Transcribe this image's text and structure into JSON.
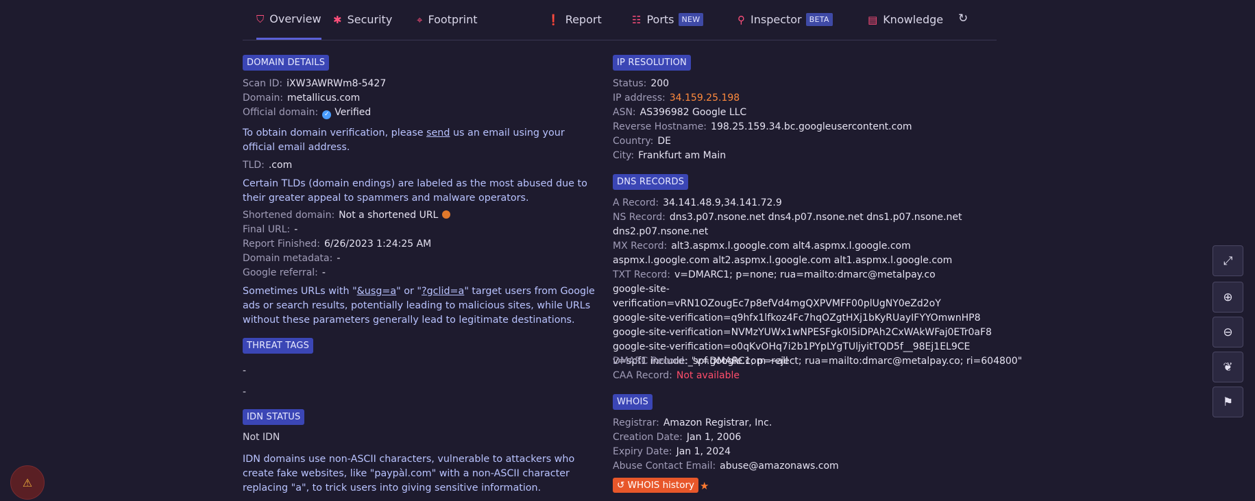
{
  "tabs": [
    {
      "label": "Overview",
      "icon": "shield-icon",
      "active": true
    },
    {
      "label": "Security",
      "icon": "bug-icon"
    },
    {
      "label": "Footprint",
      "icon": "crosshair-icon"
    },
    {
      "label": "Report",
      "icon": "exclamation-circle-icon"
    },
    {
      "label": "Ports",
      "icon": "sitemap-icon",
      "pill": "NEW"
    },
    {
      "label": "Inspector",
      "icon": "search-icon",
      "pill": "BETA"
    },
    {
      "label": "Knowledge",
      "icon": "book-icon"
    }
  ],
  "domain_details": {
    "badge": "DOMAIN DETAILS",
    "scan_id_label": "Scan ID:",
    "scan_id": "iXW3AWRWm8-5427",
    "domain_label": "Domain:",
    "domain": "metallicus.com",
    "official_label": "Official domain:",
    "official": "Verified",
    "verify_pre": "To obtain domain verification, please ",
    "verify_link": "send",
    "verify_post": " us an email using your official email address.",
    "tld_label": "TLD:",
    "tld": ".com",
    "tld_note": "Certain TLDs (domain endings) are labeled as the most abused due to their greater appeal to spammers and malware operators.",
    "shortened_label": "Shortened domain:",
    "shortened": "Not a shortened URL",
    "final_url_label": "Final URL:",
    "final_url": "-",
    "report_finished_label": "Report Finished:",
    "report_finished": "6/26/2023 1:24:25 AM",
    "metadata_label": "Domain metadata:",
    "metadata": "-",
    "referral_label": "Google referral:",
    "referral": "-",
    "referral_note_1": "Sometimes URLs with \"",
    "referral_link_1": "&usg=a",
    "referral_note_2": "\" or \"",
    "referral_link_2": "?gclid=a",
    "referral_note_3": "\" target users from Google ads or search results, potentially leading to malicious sites, while URLs without these parameters generally lead to legitimate destinations."
  },
  "threat_tags": {
    "badge": "THREAT TAGS",
    "items": [
      "-",
      "-"
    ]
  },
  "idn": {
    "badge": "IDN STATUS",
    "status": "Not IDN",
    "note": "IDN domains use non-ASCII characters, vulnerable to attackers who create fake websites, like \"paypàl.com\" with a non-ASCII character replacing \"a\", to trick users into giving sensitive information."
  },
  "ip_resolution": {
    "badge": "IP RESOLUTION",
    "status_label": "Status:",
    "status": "200",
    "ip_label": "IP address:",
    "ip": "34.159.25.198",
    "asn_label": "ASN:",
    "asn": "AS396982 Google LLC",
    "rhost_label": "Reverse Hostname:",
    "rhost": "198.25.159.34.bc.googleusercontent.com",
    "country_label": "Country:",
    "country": "DE",
    "city_label": "City:",
    "city": "Frankfurt am Main"
  },
  "dns": {
    "badge": "DNS RECORDS",
    "a_label": "A Record:",
    "a": "34.141.48.9,34.141.72.9",
    "ns_label": "NS Record:",
    "ns": "dns3.p07.nsone.net dns4.p07.nsone.net dns1.p07.nsone.net dns2.p07.nsone.net",
    "mx_label": "MX Record:",
    "mx": "alt3.aspmx.l.google.com alt4.aspmx.l.google.com aspmx.l.google.com alt2.aspmx.l.google.com alt1.aspmx.l.google.com",
    "txt_label": "TXT Record:",
    "txt_lines": [
      "v=DMARC1; p=none; rua=mailto:dmarc@metalpay.co",
      "google-site-verification=vRN1OZougEc7p8efVd4mgQXPVMFF00plUgNY0eZd2oY",
      "google-site-verification=q9hfx1lfkoz4Fc7hqOZgtHXj1bKyRUayIFYYOmwnHP8",
      "google-site-verification=NVMzYUWx1wNPESFgk0I5iDPAh2CxWAkWFaj0ETr0aF8",
      "google-site-verification=o0qKvOHq7i2b1PYpLYgTUljyitTQD5f__98Ej1EL9CE",
      "v=spf1 include:_spf.google.com ~all"
    ],
    "dmarc_label": "DMARC Record:",
    "dmarc": "\"v=DMARC1; p=reject; rua=mailto:dmarc@metalpay.co; ri=604800\"",
    "caa_label": "CAA Record:",
    "caa": "Not available"
  },
  "whois": {
    "badge": "WHOIS",
    "registrar_label": "Registrar:",
    "registrar": "Amazon Registrar, Inc.",
    "created_label": "Creation Date:",
    "created": "Jan 1, 2006",
    "expiry_label": "Expiry Date:",
    "expiry": "Jan 1, 2024",
    "abuse_label": "Abuse Contact Email:",
    "abuse": "abuse@amazonaws.com",
    "history_button": "WHOIS history"
  },
  "colors": {
    "accent": "#3b46b5",
    "ip": "#ff8a3d",
    "not_available": "#ff4d6a",
    "whois_button": "#e8572a"
  }
}
